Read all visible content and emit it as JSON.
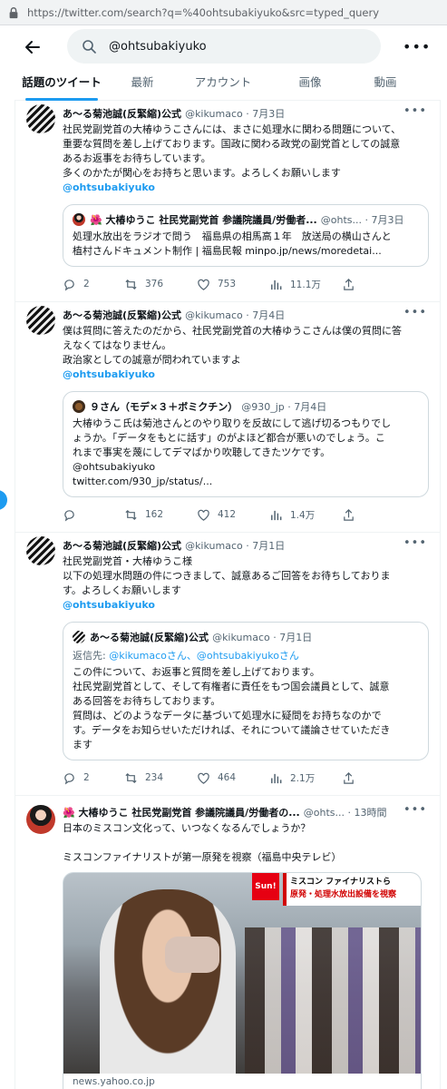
{
  "browser": {
    "url": "https://twitter.com/search?q=%40ohtsubakiyuko&src=typed_query"
  },
  "search": {
    "value": "@ohtsubakiyuko"
  },
  "tabs": [
    "話題のツイート",
    "最新",
    "アカウント",
    "画像",
    "動画"
  ],
  "tweets": [
    {
      "name": "あ～る菊池誠(反緊縮)公式",
      "handle": "@kikumaco · 7月3日",
      "text": "社民党副党首の大椿ゆうこさんには、まさに処理水に関わる問題について、\n重要な質問を差し上げております。国政に関わる政党の副党首としての誠意\nあるお返事をお待ちしています。\n多くのかたが関心をお持ちと思います。よろしくお願いします",
      "mention": "@ohtsubakiyuko",
      "quote": {
        "name": "🌺 大椿ゆうこ 社民党副党首 参議院議員/労働者...",
        "handle": "@ohts... · 7月3日",
        "text": "処理水放出をラジオで問う　福島県の相馬高１年　放送局の横山さんと\n植村さんドキュメント制作 | 福島民報 minpo.jp/news/moredetai..."
      },
      "actions": {
        "reply": "2",
        "retweet": "376",
        "like": "753",
        "views": "11.1万"
      }
    },
    {
      "name": "あ～る菊池誠(反緊縮)公式",
      "handle": "@kikumaco · 7月4日",
      "text": "僕は質問に答えたのだから、社民党副党首の大椿ゆうこさんは僕の質問に答\nえなくてはなりません。\n政治家としての誠意が問われていますよ",
      "mention": "@ohtsubakiyuko",
      "quote": {
        "name": "９さん（モデ×３＋ボミクチン）",
        "handle": "@930_jp · 7月4日",
        "text": "大椿ゆうこ氏は菊池さんとのやり取りを反故にして逃げ切るつもりでし\nょうか。「データをもとに話す」のがよほど都合が悪いのでしょう。こ\nれまで事実を蔑にしてデマばかり吹聴してきたツケです。\n@ohtsubakiyuko\ntwitter.com/930_jp/status/..."
      },
      "actions": {
        "reply": "",
        "retweet": "162",
        "like": "412",
        "views": "1.4万"
      }
    },
    {
      "name": "あ～る菊池誠(反緊縮)公式",
      "handle": "@kikumaco · 7月1日",
      "text": "社民党副党首・大椿ゆうこ様\n以下の処理水問題の件につきまして、誠意あるご回答をお待ちしておりま\nす。よろしくお願いします",
      "mention": "@ohtsubakiyuko",
      "quote": {
        "name": "あ～る菊池誠(反緊縮)公式",
        "handle": "@kikumaco · 7月1日",
        "reply_prefix": "返信先: ",
        "reply_to": "@kikumacoさん、@ohtsubakiyukoさん",
        "text": "この件について、お返事と質問を差し上げております。\n社民党副党首として、そして有権者に責任をもつ国会議員として、誠意\nある回答をお待ちしております。\n質問は、どのようなデータに基づいて処理水に疑問をお持ちなのかで\nす。データをお知らせいただければ、それについて議論させていただき\nます"
      },
      "actions": {
        "reply": "2",
        "retweet": "234",
        "like": "464",
        "views": "2.1万"
      }
    },
    {
      "name": "🌺 大椿ゆうこ 社民党副党首 参議院議員/労働者の...",
      "handle": "@ohts... · 13時間",
      "text": "日本のミスコン文化って、いつなくなるんでしょうか？\n\nミスコンファイナリストが第一原発を視察（福島中央テレビ）",
      "media": {
        "sun_label": "Sun!",
        "banner_line1": "ミスコン ファイナリストら",
        "banner_line2": "原発・処理水放出設備を視察"
      },
      "link_source": "news.yahoo.co.jp"
    }
  ]
}
